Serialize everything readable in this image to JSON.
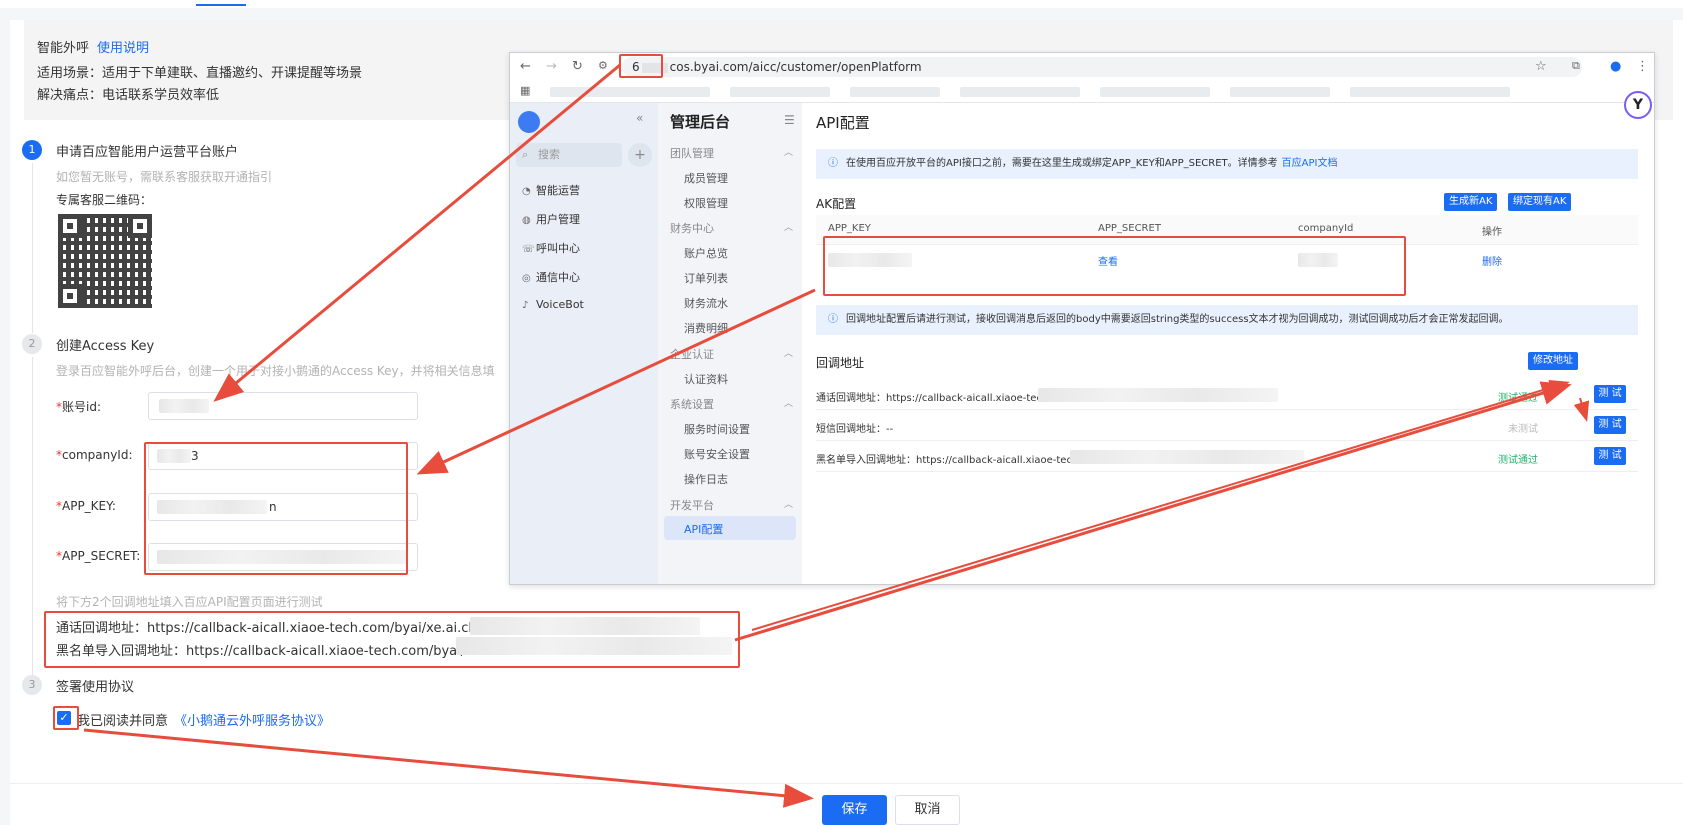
{
  "intro": {
    "title": "智能外呼",
    "help_link": "使用说明",
    "scene": "适用场景：适用于下单建联、直播邀约、开课提醒等场景",
    "pain": "解决痛点：电话联系学员效率低"
  },
  "steps": [
    {
      "num": "1",
      "title": "申请百应智能用户运营平台账户",
      "hint": "如您暂无账号，需联系客服获取开通指引",
      "qr_label": "专属客服二维码："
    },
    {
      "num": "2",
      "title": "创建Access Key",
      "hint": "登录百应智能外呼后台，创建一个用于对接小鹅通的Access Key，并将相关信息填"
    },
    {
      "num": "3",
      "title": "签署使用协议"
    }
  ],
  "form": {
    "account_label": "账号id:",
    "company_label": "companyId:",
    "company_value": "3",
    "appkey_label": "APP_KEY:",
    "appkey_value": "n",
    "secret_label": "APP_SECRET:",
    "callback_hint": "将下方2个回调地址填入百应API配置页面进行测试",
    "callback_call": "通话回调地址：https://callback-aicall.xiaoe-tech.com/byai/xe.ai.cllba",
    "callback_blacklist": "黑名单导入回调地址：https://callback-aicall.xiaoe-tech.com/byai/xe"
  },
  "agreement": {
    "text": "我已阅读并同意",
    "link": "《小鹅通云外呼服务协议》"
  },
  "actions": {
    "save": "保存",
    "cancel": "取消"
  },
  "browser": {
    "url_prefix": "6",
    "url_rest": "cos.byai.com/aicc/customer/openPlatform",
    "sidebar1": {
      "search_placeholder": "搜索",
      "items": [
        "智能运营",
        "用户管理",
        "呼叫中心",
        "通信中心",
        "VoiceBot"
      ]
    },
    "sidebar2": {
      "title": "管理后台",
      "groups": [
        {
          "label": "团队管理",
          "items": [
            "成员管理",
            "权限管理"
          ]
        },
        {
          "label": "财务中心",
          "items": [
            "账户总览",
            "订单列表",
            "财务流水",
            "消费明细"
          ]
        },
        {
          "label": "企业认证",
          "items": [
            "认证资料"
          ]
        },
        {
          "label": "系统设置",
          "items": [
            "服务时间设置",
            "账号安全设置",
            "操作日志"
          ]
        },
        {
          "label": "开发平台",
          "items": [
            "API配置"
          ]
        }
      ]
    },
    "content": {
      "title": "API配置",
      "info1": "在使用百应开放平台的API接口之前，需要在这里生成或绑定APP_KEY和APP_SECRET。详情参考",
      "info1_link": "百应API文档",
      "ak_title": "AK配置",
      "btn_generate": "生成新AK",
      "btn_bind": "绑定现有AK",
      "table_headers": [
        "APP_KEY",
        "APP_SECRET",
        "companyId",
        "操作"
      ],
      "view_link": "查看",
      "delete_link": "删除",
      "info2": "回调地址配置后请进行测试，接收回调消息后返回的body中需要返回string类型的success文本才视为回调成功，测试回调成功后才会正常发起回调。",
      "callback_title": "回调地址",
      "btn_modify": "修改地址",
      "callbacks": [
        {
          "label": "通话回调地址：https://callback-aicall.xiaoe-tech.cc",
          "status": "测试通过",
          "button": "测 试"
        },
        {
          "label": "短信回调地址：--",
          "status": "未测试",
          "button": "测 试"
        },
        {
          "label": "黑名单导入回调地址：https://callback-aicall.xiaoe-tec",
          "status": "测试通过",
          "button": "测 试"
        }
      ]
    }
  },
  "colors": {
    "accent": "#1a6cf2",
    "annotation": "#e74c3c",
    "success": "#20b26b"
  }
}
